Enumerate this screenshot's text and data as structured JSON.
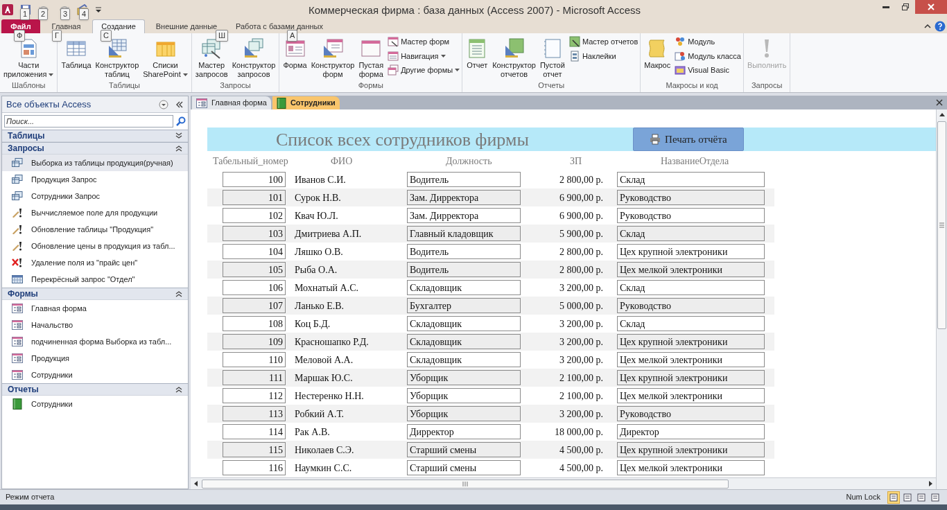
{
  "window": {
    "title": "Коммерческая фирма : база данных (Access 2007)  -  Microsoft Access"
  },
  "quick_access": {
    "keytips": [
      "1",
      "2",
      "3",
      "4"
    ]
  },
  "ribbon": {
    "tabs": [
      {
        "label": "Файл",
        "kind": "file",
        "selected": false,
        "keytip": "Ф"
      },
      {
        "label": "Главная",
        "kind": "tab",
        "selected": false,
        "keytip": "Г"
      },
      {
        "label": "Создание",
        "kind": "tab",
        "selected": true,
        "keytip": "С"
      },
      {
        "label": "Внешние данные",
        "kind": "tab",
        "selected": false,
        "keytip": "Ш"
      },
      {
        "label": "Работа с базами данных",
        "kind": "tab",
        "selected": false,
        "keytip": "А"
      }
    ],
    "groups": [
      {
        "label": "Шаблоны",
        "buttons": [
          {
            "kind": "large",
            "lines": [
              "Части",
              "приложения"
            ],
            "dropdown": true,
            "disabled": false
          }
        ]
      },
      {
        "label": "Таблицы",
        "buttons": [
          {
            "kind": "large",
            "lines": [
              "Таблица"
            ],
            "dropdown": false,
            "disabled": false
          },
          {
            "kind": "large",
            "lines": [
              "Конструктор",
              "таблиц"
            ],
            "dropdown": false,
            "disabled": false
          },
          {
            "kind": "large",
            "lines": [
              "Списки",
              "SharePoint"
            ],
            "dropdown": true,
            "disabled": false
          }
        ]
      },
      {
        "label": "Запросы",
        "buttons": [
          {
            "kind": "large",
            "lines": [
              "Мастер",
              "запросов"
            ],
            "dropdown": false,
            "disabled": false
          },
          {
            "kind": "large",
            "lines": [
              "Конструктор",
              "запросов"
            ],
            "dropdown": false,
            "disabled": false
          }
        ]
      },
      {
        "label": "Формы",
        "buttons": [
          {
            "kind": "large",
            "lines": [
              "Форма"
            ],
            "dropdown": false,
            "disabled": false
          },
          {
            "kind": "large",
            "lines": [
              "Конструктор",
              "форм"
            ],
            "dropdown": false,
            "disabled": false
          },
          {
            "kind": "large",
            "lines": [
              "Пустая",
              "форма"
            ],
            "dropdown": false,
            "disabled": false
          },
          {
            "kind": "small",
            "lines": [
              "Мастер форм"
            ],
            "dropdown": false,
            "disabled": false
          },
          {
            "kind": "small",
            "lines": [
              "Навигация"
            ],
            "dropdown": true,
            "disabled": false
          },
          {
            "kind": "small",
            "lines": [
              "Другие формы"
            ],
            "dropdown": true,
            "disabled": false
          }
        ]
      },
      {
        "label": "Отчеты",
        "buttons": [
          {
            "kind": "large",
            "lines": [
              "Отчет"
            ],
            "dropdown": false,
            "disabled": false
          },
          {
            "kind": "large",
            "lines": [
              "Конструктор",
              "отчетов"
            ],
            "dropdown": false,
            "disabled": false
          },
          {
            "kind": "large",
            "lines": [
              "Пустой",
              "отчет"
            ],
            "dropdown": false,
            "disabled": false
          },
          {
            "kind": "small",
            "lines": [
              "Мастер отчетов"
            ],
            "dropdown": false,
            "disabled": false
          },
          {
            "kind": "small",
            "lines": [
              "Наклейки"
            ],
            "dropdown": false,
            "disabled": false
          }
        ]
      },
      {
        "label": "Макросы и код",
        "buttons": [
          {
            "kind": "large",
            "lines": [
              "Макрос"
            ],
            "dropdown": false,
            "disabled": false
          },
          {
            "kind": "small",
            "lines": [
              "Модуль"
            ],
            "dropdown": false,
            "disabled": false
          },
          {
            "kind": "small",
            "lines": [
              "Модуль класса"
            ],
            "dropdown": false,
            "disabled": false
          },
          {
            "kind": "small",
            "lines": [
              "Visual Basic"
            ],
            "dropdown": false,
            "disabled": false
          }
        ]
      },
      {
        "label": "Запросы",
        "buttons": [
          {
            "kind": "large",
            "lines": [
              "Выполнить"
            ],
            "dropdown": false,
            "disabled": true
          }
        ]
      }
    ]
  },
  "nav_pane": {
    "title": "Все объекты Access",
    "search": {
      "placeholder": "Поиск..."
    },
    "sections": [
      {
        "label": "Таблицы",
        "expanded": false
      },
      {
        "label": "Запросы",
        "expanded": true,
        "items": [
          {
            "label": "Выборка из таблицы продукция(ручная)",
            "kind": "select",
            "selected": true
          },
          {
            "label": "Продукция Запрос",
            "kind": "select",
            "selected": false
          },
          {
            "label": "Сотрудники Запрос",
            "kind": "select",
            "selected": false
          },
          {
            "label": "Выччисляемое поле для продукции",
            "kind": "update",
            "selected": false
          },
          {
            "label": "Обновление таблицы \"Продукция\"",
            "kind": "update",
            "selected": false
          },
          {
            "label": "Обновление цены в продукция из табл...",
            "kind": "update",
            "selected": false
          },
          {
            "label": "Удаление поля из \"прайс цен\"",
            "kind": "delete",
            "selected": false
          },
          {
            "label": "Перекрёсный запрос \"Отдел\"",
            "kind": "crosstab",
            "selected": false
          }
        ]
      },
      {
        "label": "Формы",
        "expanded": true,
        "items": [
          {
            "label": "Главная форма",
            "kind": "form",
            "selected": false
          },
          {
            "label": "Начальство",
            "kind": "form",
            "selected": false
          },
          {
            "label": "подчиненная форма Выборка из табл...",
            "kind": "form",
            "selected": false
          },
          {
            "label": "Продукция",
            "kind": "form",
            "selected": false
          },
          {
            "label": "Сотрудники",
            "kind": "form",
            "selected": false
          }
        ]
      },
      {
        "label": "Отчеты",
        "expanded": true,
        "items": [
          {
            "label": "Сотрудники",
            "kind": "report",
            "selected": false
          }
        ]
      }
    ]
  },
  "document_tabs": [
    {
      "label": "Главная форма",
      "kind": "form",
      "selected": false
    },
    {
      "label": "Сотрудники",
      "kind": "report",
      "selected": true
    }
  ],
  "report": {
    "title": "Список всех сотрудников фирмы",
    "print_button": "Печать отчёта",
    "columns": [
      "Табельный_номер",
      "ФИО",
      "Должность",
      "ЗП",
      "НазваниеОтдела"
    ],
    "rows": [
      [
        "100",
        "Иванов С.И.",
        "Водитель",
        "2 800,00 р.",
        "Склад"
      ],
      [
        "101",
        "Сурок Н.В.",
        "Зам. Дирректора",
        "6 900,00 р.",
        "Руководство"
      ],
      [
        "102",
        "Квач Ю.Л.",
        "Зам. Дирректора",
        "6 900,00 р.",
        "Руководство"
      ],
      [
        "103",
        "Дмитриева А.П.",
        "Главный кладовщик",
        "5 900,00 р.",
        "Склад"
      ],
      [
        "104",
        "Ляшко О.В.",
        "Водитель",
        "2 800,00 р.",
        "Цех крупной электроники"
      ],
      [
        "105",
        "Рыба О.А.",
        "Водитель",
        "2 800,00 р.",
        "Цех мелкой электроники"
      ],
      [
        "106",
        "Мохнатый А.С.",
        "Складовщик",
        "3 200,00 р.",
        "Склад"
      ],
      [
        "107",
        "Ланько Е.В.",
        "Бухгалтер",
        "5 000,00 р.",
        "Руководство"
      ],
      [
        "108",
        "Коц Б.Д.",
        "Складовщик",
        "3 200,00 р.",
        "Склад"
      ],
      [
        "109",
        "Красношапко Р.Д.",
        "Складовщик",
        "3 200,00 р.",
        "Цех крупной электроники"
      ],
      [
        "110",
        "Меловой А.А.",
        "Складовщик",
        "3 200,00 р.",
        "Цех мелкой электроники"
      ],
      [
        "111",
        "Маршак Ю.С.",
        "Уборщик",
        "2 100,00 р.",
        "Цех крупной электроники"
      ],
      [
        "112",
        "Нестеренко Н.Н.",
        "Уборщик",
        "2 100,00 р.",
        "Цех мелкой электроники"
      ],
      [
        "113",
        "Робкий А.Т.",
        "Уборщик",
        "3 200,00 р.",
        "Руководство"
      ],
      [
        "114",
        "Рак А.В.",
        "Дирректор",
        "18 000,00 р.",
        "Директор"
      ],
      [
        "115",
        "Николаев С.Э.",
        "Старший смены",
        "4 500,00 р.",
        "Цех крупной электроники"
      ],
      [
        "116",
        "Наумкин С.С.",
        "Старший смены",
        "4 500,00 р.",
        "Цех мелкой электроники"
      ]
    ]
  },
  "status_bar": {
    "text": "Режим отчета",
    "indicator": "Num Lock",
    "views": [
      {
        "selected": true
      },
      {
        "selected": false
      },
      {
        "selected": false
      },
      {
        "selected": false
      }
    ]
  }
}
